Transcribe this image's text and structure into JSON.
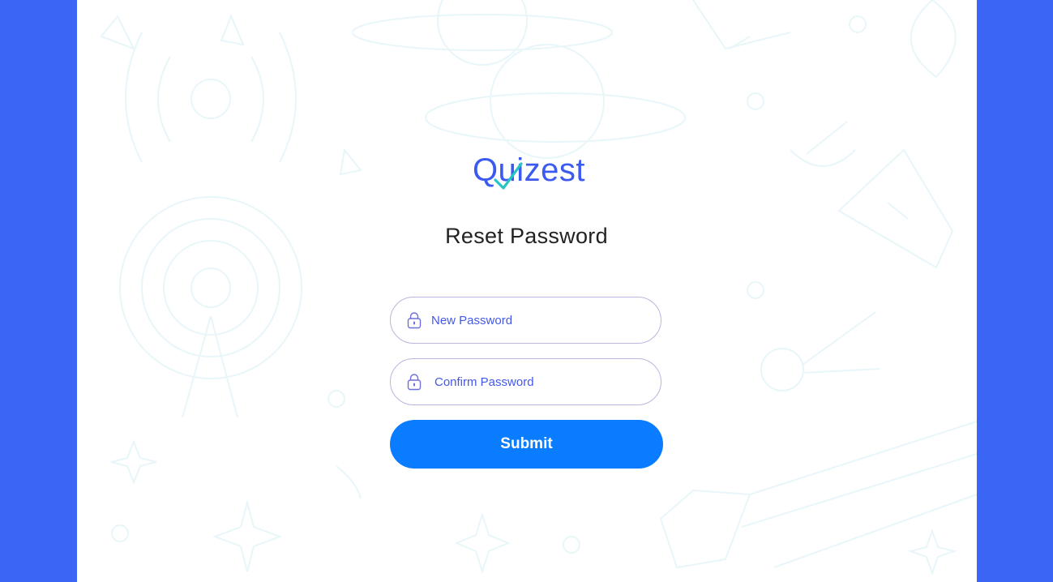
{
  "brand": {
    "logo_text": "Quizest",
    "logo_color": "#3b5bf0",
    "check_color": "#27c4c4"
  },
  "page": {
    "title": "Reset Password",
    "outer_background": "#3b66f5"
  },
  "form": {
    "new_password": {
      "placeholder": "New Password",
      "icon": "lock-icon"
    },
    "confirm_password": {
      "placeholder": "Confirm Password",
      "icon": "lock-icon"
    },
    "submit_label": "Submit",
    "submit_color": "#0a7cff"
  }
}
